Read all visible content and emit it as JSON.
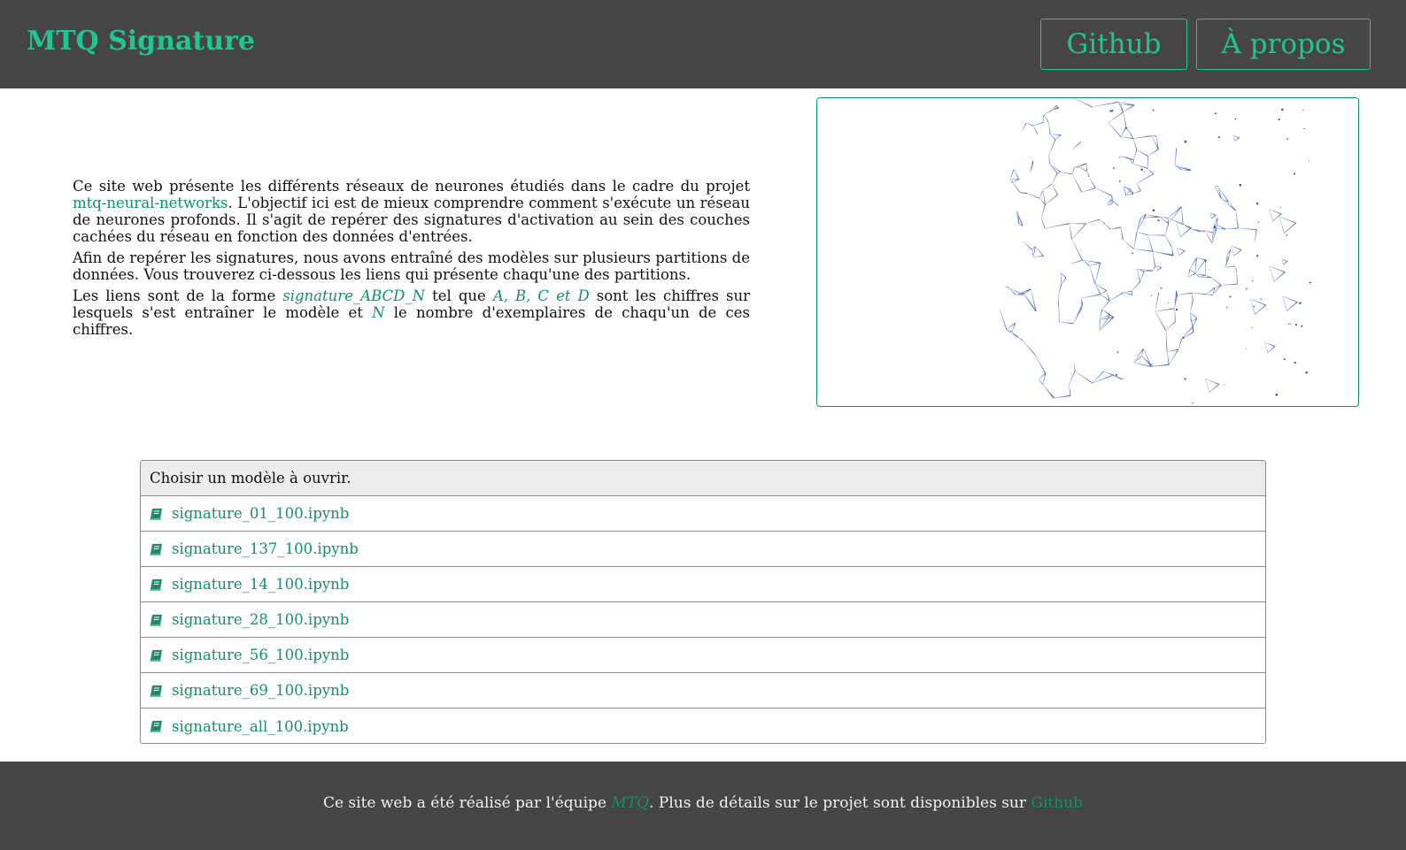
{
  "header": {
    "brand": "MTQ Signature",
    "nav": {
      "github": "Github",
      "about": "À propos"
    }
  },
  "intro": {
    "p1_before": "Ce site web présente les différents réseaux de neurones étudiés dans le cadre du projet ",
    "p1_link": "mtq-neural-networks",
    "p1_after": ". L'objectif ici est de mieux comprendre comment s'exécute un réseau de neurones profonds. Il s'agit de repérer des signatures d'activation au sein des couches cachées du réseau en fonction des données d'entrées.",
    "p2": "Afin de repérer les signatures, nous avons entraîné des modèles sur plusieurs partitions de données. Vous trouverez ci-dessous les liens qui présente chaqu'une des partitions.",
    "p3_a": "Les liens sont de la forme ",
    "p3_b": "signature_ABCD_N",
    "p3_c": " tel que ",
    "p3_d": "A, B, C et D",
    "p3_e": " sont les chiffres sur lesquels s'est entraîner le modèle et ",
    "p3_f": "N",
    "p3_g": " le nombre d'exemplaires de chaqu'un de ces chiffres."
  },
  "hero": {
    "image": "polygonal-head-illustration"
  },
  "models": {
    "header": "Choisir un modèle à ouvrir.",
    "icon": "book-icon",
    "items": [
      "signature_01_100.ipynb",
      "signature_137_100.ipynb",
      "signature_14_100.ipynb",
      "signature_28_100.ipynb",
      "signature_56_100.ipynb",
      "signature_69_100.ipynb",
      "signature_all_100.ipynb"
    ]
  },
  "footer": {
    "before": "Ce site web a été réalisé par l'équipe ",
    "team": "MTQ",
    "middle": ". Plus de détails sur le projet sont disponibles sur ",
    "link": "Github"
  },
  "colors": {
    "accent": "#1ec694",
    "link": "#11906a",
    "bar": "#454545",
    "panel_header": "#ececec",
    "mesh": "#4a5fa8"
  }
}
